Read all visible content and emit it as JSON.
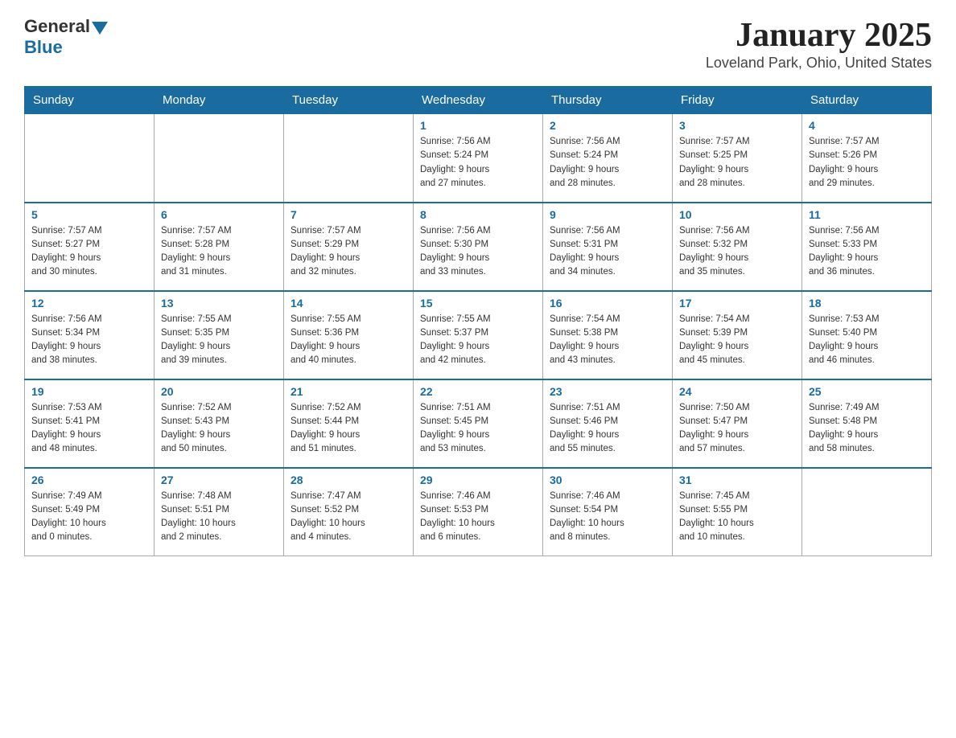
{
  "header": {
    "logo_general": "General",
    "logo_blue": "Blue",
    "title": "January 2025",
    "subtitle": "Loveland Park, Ohio, United States"
  },
  "days_of_week": [
    "Sunday",
    "Monday",
    "Tuesday",
    "Wednesday",
    "Thursday",
    "Friday",
    "Saturday"
  ],
  "weeks": [
    [
      {
        "day": "",
        "info": ""
      },
      {
        "day": "",
        "info": ""
      },
      {
        "day": "",
        "info": ""
      },
      {
        "day": "1",
        "info": "Sunrise: 7:56 AM\nSunset: 5:24 PM\nDaylight: 9 hours\nand 27 minutes."
      },
      {
        "day": "2",
        "info": "Sunrise: 7:56 AM\nSunset: 5:24 PM\nDaylight: 9 hours\nand 28 minutes."
      },
      {
        "day": "3",
        "info": "Sunrise: 7:57 AM\nSunset: 5:25 PM\nDaylight: 9 hours\nand 28 minutes."
      },
      {
        "day": "4",
        "info": "Sunrise: 7:57 AM\nSunset: 5:26 PM\nDaylight: 9 hours\nand 29 minutes."
      }
    ],
    [
      {
        "day": "5",
        "info": "Sunrise: 7:57 AM\nSunset: 5:27 PM\nDaylight: 9 hours\nand 30 minutes."
      },
      {
        "day": "6",
        "info": "Sunrise: 7:57 AM\nSunset: 5:28 PM\nDaylight: 9 hours\nand 31 minutes."
      },
      {
        "day": "7",
        "info": "Sunrise: 7:57 AM\nSunset: 5:29 PM\nDaylight: 9 hours\nand 32 minutes."
      },
      {
        "day": "8",
        "info": "Sunrise: 7:56 AM\nSunset: 5:30 PM\nDaylight: 9 hours\nand 33 minutes."
      },
      {
        "day": "9",
        "info": "Sunrise: 7:56 AM\nSunset: 5:31 PM\nDaylight: 9 hours\nand 34 minutes."
      },
      {
        "day": "10",
        "info": "Sunrise: 7:56 AM\nSunset: 5:32 PM\nDaylight: 9 hours\nand 35 minutes."
      },
      {
        "day": "11",
        "info": "Sunrise: 7:56 AM\nSunset: 5:33 PM\nDaylight: 9 hours\nand 36 minutes."
      }
    ],
    [
      {
        "day": "12",
        "info": "Sunrise: 7:56 AM\nSunset: 5:34 PM\nDaylight: 9 hours\nand 38 minutes."
      },
      {
        "day": "13",
        "info": "Sunrise: 7:55 AM\nSunset: 5:35 PM\nDaylight: 9 hours\nand 39 minutes."
      },
      {
        "day": "14",
        "info": "Sunrise: 7:55 AM\nSunset: 5:36 PM\nDaylight: 9 hours\nand 40 minutes."
      },
      {
        "day": "15",
        "info": "Sunrise: 7:55 AM\nSunset: 5:37 PM\nDaylight: 9 hours\nand 42 minutes."
      },
      {
        "day": "16",
        "info": "Sunrise: 7:54 AM\nSunset: 5:38 PM\nDaylight: 9 hours\nand 43 minutes."
      },
      {
        "day": "17",
        "info": "Sunrise: 7:54 AM\nSunset: 5:39 PM\nDaylight: 9 hours\nand 45 minutes."
      },
      {
        "day": "18",
        "info": "Sunrise: 7:53 AM\nSunset: 5:40 PM\nDaylight: 9 hours\nand 46 minutes."
      }
    ],
    [
      {
        "day": "19",
        "info": "Sunrise: 7:53 AM\nSunset: 5:41 PM\nDaylight: 9 hours\nand 48 minutes."
      },
      {
        "day": "20",
        "info": "Sunrise: 7:52 AM\nSunset: 5:43 PM\nDaylight: 9 hours\nand 50 minutes."
      },
      {
        "day": "21",
        "info": "Sunrise: 7:52 AM\nSunset: 5:44 PM\nDaylight: 9 hours\nand 51 minutes."
      },
      {
        "day": "22",
        "info": "Sunrise: 7:51 AM\nSunset: 5:45 PM\nDaylight: 9 hours\nand 53 minutes."
      },
      {
        "day": "23",
        "info": "Sunrise: 7:51 AM\nSunset: 5:46 PM\nDaylight: 9 hours\nand 55 minutes."
      },
      {
        "day": "24",
        "info": "Sunrise: 7:50 AM\nSunset: 5:47 PM\nDaylight: 9 hours\nand 57 minutes."
      },
      {
        "day": "25",
        "info": "Sunrise: 7:49 AM\nSunset: 5:48 PM\nDaylight: 9 hours\nand 58 minutes."
      }
    ],
    [
      {
        "day": "26",
        "info": "Sunrise: 7:49 AM\nSunset: 5:49 PM\nDaylight: 10 hours\nand 0 minutes."
      },
      {
        "day": "27",
        "info": "Sunrise: 7:48 AM\nSunset: 5:51 PM\nDaylight: 10 hours\nand 2 minutes."
      },
      {
        "day": "28",
        "info": "Sunrise: 7:47 AM\nSunset: 5:52 PM\nDaylight: 10 hours\nand 4 minutes."
      },
      {
        "day": "29",
        "info": "Sunrise: 7:46 AM\nSunset: 5:53 PM\nDaylight: 10 hours\nand 6 minutes."
      },
      {
        "day": "30",
        "info": "Sunrise: 7:46 AM\nSunset: 5:54 PM\nDaylight: 10 hours\nand 8 minutes."
      },
      {
        "day": "31",
        "info": "Sunrise: 7:45 AM\nSunset: 5:55 PM\nDaylight: 10 hours\nand 10 minutes."
      },
      {
        "day": "",
        "info": ""
      }
    ]
  ]
}
